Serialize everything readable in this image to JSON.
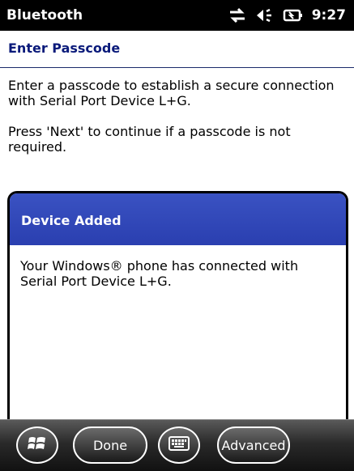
{
  "statusbar": {
    "title": "Bluetooth",
    "time": "9:27",
    "icons": [
      "connectivity-icon",
      "volume-icon",
      "battery-icon"
    ]
  },
  "header": {
    "title": "Enter Passcode"
  },
  "content": {
    "paragraph1": "Enter a passcode to establish a secure connection with Serial Port Device L+G.",
    "paragraph2": "Press 'Next' to continue if a passcode is not required."
  },
  "dialog": {
    "title": "Device Added",
    "message": "Your Windows® phone has connected with Serial Port Device L+G."
  },
  "toolbar": {
    "start_icon": "windows-start-icon",
    "done_label": "Done",
    "keyboard_icon": "keyboard-icon",
    "advanced_label": "Advanced"
  }
}
